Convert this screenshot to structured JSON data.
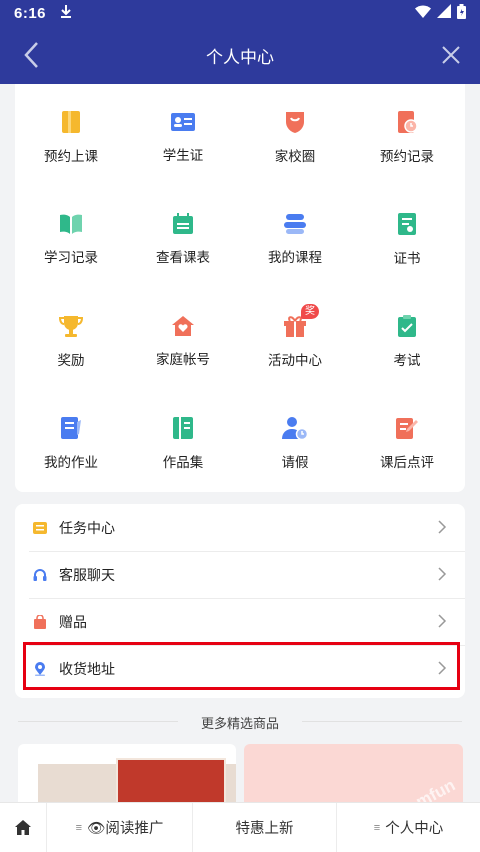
{
  "status_bar": {
    "time": "6:16"
  },
  "nav": {
    "title": "个人中心"
  },
  "grid": [
    {
      "label": "预约上课",
      "icon": "book-icon",
      "color": "#f5b82e"
    },
    {
      "label": "学生证",
      "icon": "id-card-icon",
      "color": "#4a7cf0"
    },
    {
      "label": "家校圈",
      "icon": "shield-icon",
      "color": "#f0705a"
    },
    {
      "label": "预约记录",
      "icon": "clock-doc-icon",
      "color": "#f0705a"
    },
    {
      "label": "学习记录",
      "icon": "open-book-icon",
      "color": "#2fb88a"
    },
    {
      "label": "查看课表",
      "icon": "calendar-icon",
      "color": "#2fb88a"
    },
    {
      "label": "我的课程",
      "icon": "course-icon",
      "color": "#4a7cf0"
    },
    {
      "label": "证书",
      "icon": "certificate-icon",
      "color": "#2fb88a"
    },
    {
      "label": "奖励",
      "icon": "trophy-icon",
      "color": "#f5b82e"
    },
    {
      "label": "家庭帐号",
      "icon": "home-heart-icon",
      "color": "#f0705a"
    },
    {
      "label": "活动中心",
      "icon": "gift-icon",
      "color": "#f0705a",
      "badge": "奖"
    },
    {
      "label": "考试",
      "icon": "exam-clipboard-icon",
      "color": "#2fb88a"
    },
    {
      "label": "我的作业",
      "icon": "homework-icon",
      "color": "#4a7cf0"
    },
    {
      "label": "作品集",
      "icon": "portfolio-icon",
      "color": "#2fb88a"
    },
    {
      "label": "请假",
      "icon": "person-clock-icon",
      "color": "#4a7cf0"
    },
    {
      "label": "课后点评",
      "icon": "pencil-doc-icon",
      "color": "#f0705a"
    }
  ],
  "list": [
    {
      "label": "任务中心",
      "icon": "task-icon",
      "color": "#f5b82e"
    },
    {
      "label": "客服聊天",
      "icon": "headset-icon",
      "color": "#4a7cf0"
    },
    {
      "label": "赠品",
      "icon": "gift-bag-icon",
      "color": "#f0705a"
    },
    {
      "label": "收货地址",
      "icon": "location-pin-icon",
      "color": "#4a7cf0"
    }
  ],
  "section": {
    "title": "更多精选商品"
  },
  "products": {
    "watermark": "mfun"
  },
  "bottom_nav": {
    "menu_glyph": "≡",
    "read_promo": "👁阅读推广",
    "specials": "特惠上新",
    "personal": "个人中心"
  }
}
